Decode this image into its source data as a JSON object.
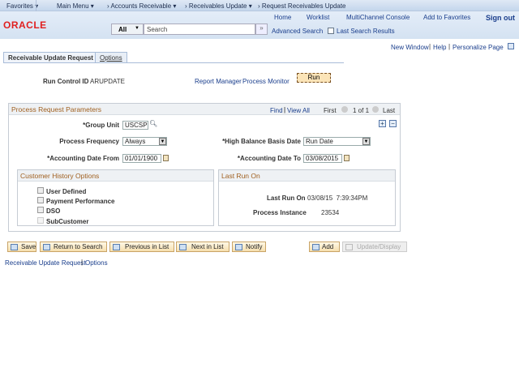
{
  "topnav": {
    "favorites": "Favorites",
    "main_menu": "Main Menu",
    "breadcrumbs": [
      "Accounts Receivable",
      "Receivables Update",
      "Request Receivables Update"
    ]
  },
  "header": {
    "logo": "ORACLE",
    "links": [
      "Home",
      "Worklist",
      "MultiChannel Console",
      "Add to Favorites",
      "Sign out"
    ],
    "search_scope": "All",
    "search_placeholder": "Search",
    "advanced_search": "Advanced Search",
    "last_search": "Last Search Results"
  },
  "pagebar": {
    "new_window": "New Window",
    "help": "Help",
    "personalize": "Personalize Page"
  },
  "tabs": [
    "Receivable Update Request",
    "Options"
  ],
  "run": {
    "run_control_label": "Run Control ID",
    "run_control_value": "ARUPDATE",
    "report_manager": "Report Manager",
    "process_monitor": "Process Monitor",
    "run_button": "Run"
  },
  "params": {
    "title": "Process Request Parameters",
    "find": "Find",
    "view_all": "View All",
    "first": "First",
    "count": "1 of 1",
    "last": "Last",
    "group_unit_label": "*Group Unit",
    "group_unit": "USCSP",
    "freq_label": "Process Frequency",
    "freq": "Always",
    "hb_label": "*High Balance Basis Date",
    "hb": "Run Date",
    "from_label": "*Accounting Date From",
    "from": "01/01/1900",
    "to_label": "*Accounting Date To",
    "to": "03/08/2015"
  },
  "history": {
    "title": "Customer History Options",
    "options": [
      "User Defined",
      "Payment Performance",
      "DSO",
      "SubCustomer"
    ]
  },
  "lastrun": {
    "title": "Last Run On",
    "label": "Last Run On",
    "value": "03/08/15  7:39:34PM",
    "pi_label": "Process Instance",
    "pi": "23534"
  },
  "buttons": {
    "save": "Save",
    "return": "Return to Search",
    "prev": "Previous in List",
    "next": "Next in List",
    "notify": "Notify",
    "add": "Add",
    "update": "Update/Display"
  },
  "footer": {
    "link1": "Receivable Update Request",
    "link2": "Options"
  }
}
